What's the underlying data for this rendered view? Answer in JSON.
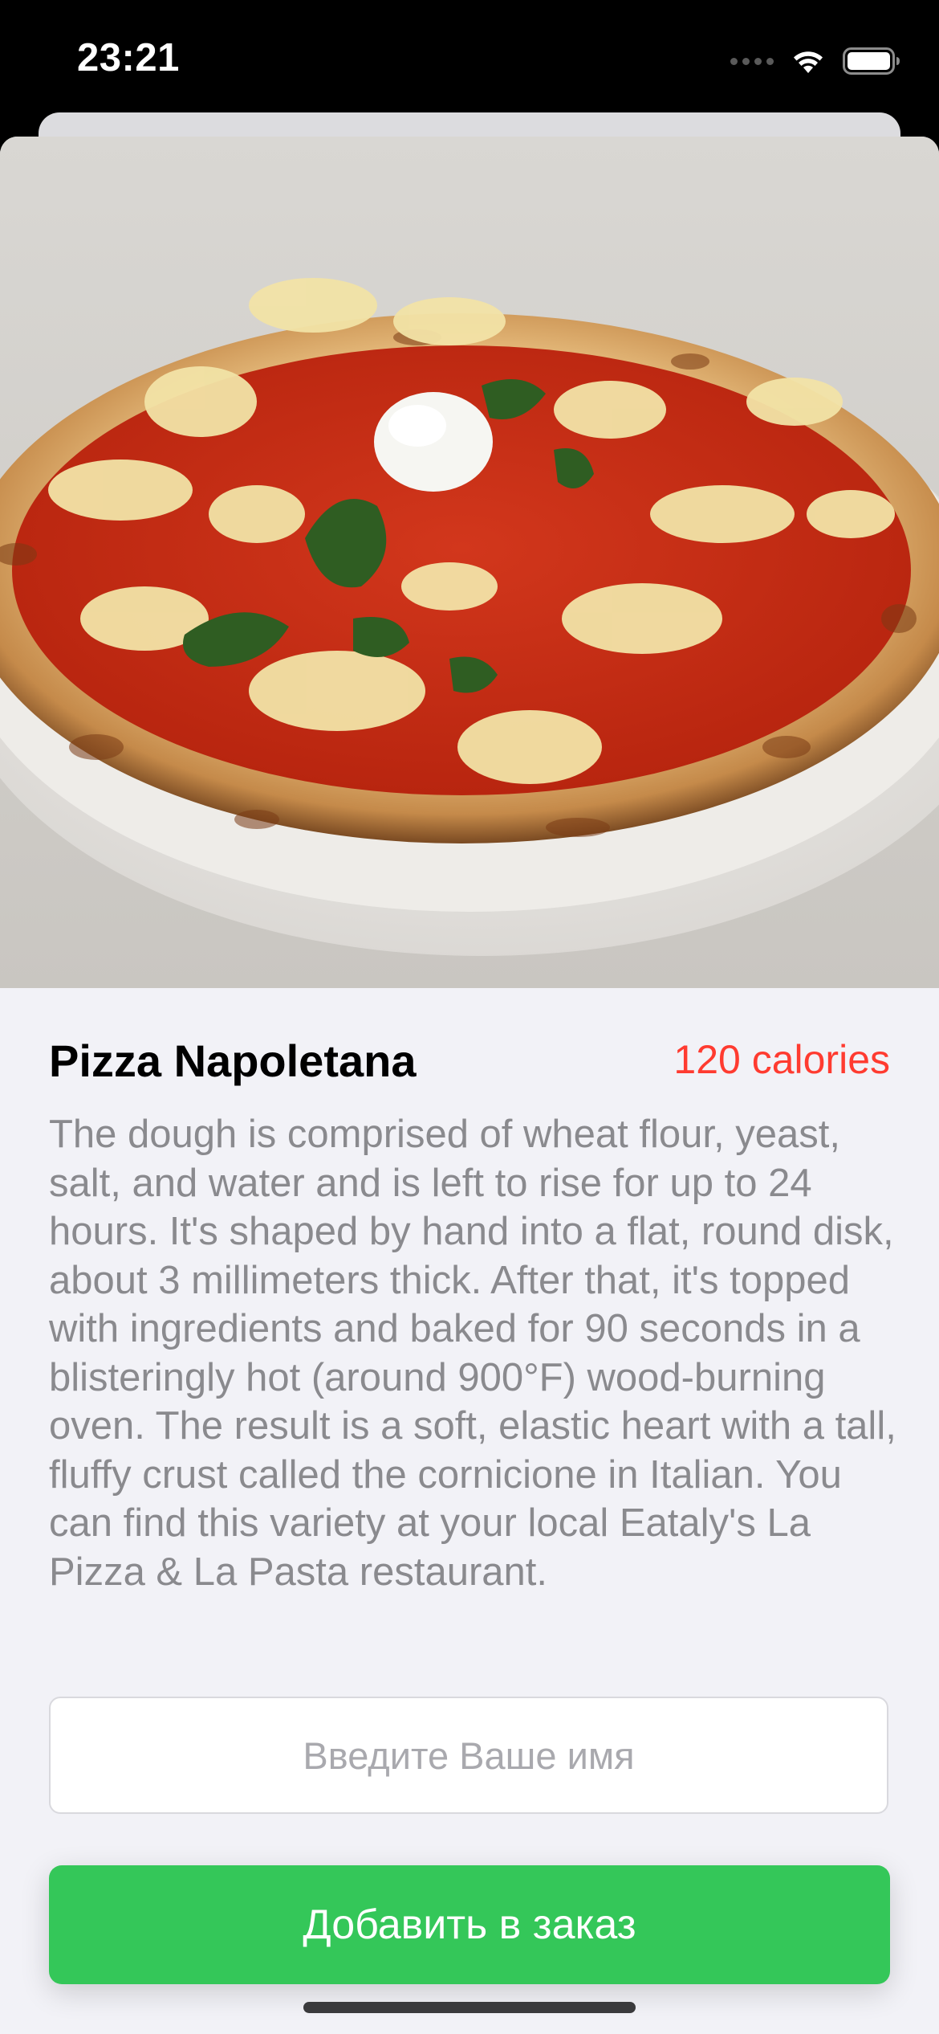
{
  "status_bar": {
    "time": "23:21",
    "icons": [
      "signal-dots-icon",
      "wifi-icon",
      "battery-icon"
    ]
  },
  "product": {
    "image_subject": "pizza-photo",
    "title": "Pizza Napoletana",
    "calories": "120 calories",
    "description": "The dough is comprised of wheat flour, yeast, salt, and water and is left to rise for up to 24 hours. It's shaped by hand into a flat, round disk, about 3 millimeters thick. After that, it's topped with ingredients and baked for 90 seconds in a blisteringly hot (around 900°F) wood-burning oven. The result is a soft, elastic heart with a tall, fluffy crust called the cornicione in Italian. You can find this variety at your local Eataly's La Pizza & La Pasta restaurant."
  },
  "order_form": {
    "name_placeholder": "Введите Ваше имя",
    "name_value": "",
    "add_button_label": "Добавить в заказ"
  },
  "colors": {
    "accent_green": "#34c759",
    "calories_red": "#ff3b30",
    "sheet_background": "#f2f2f7",
    "description_gray": "#8a8a8e"
  }
}
